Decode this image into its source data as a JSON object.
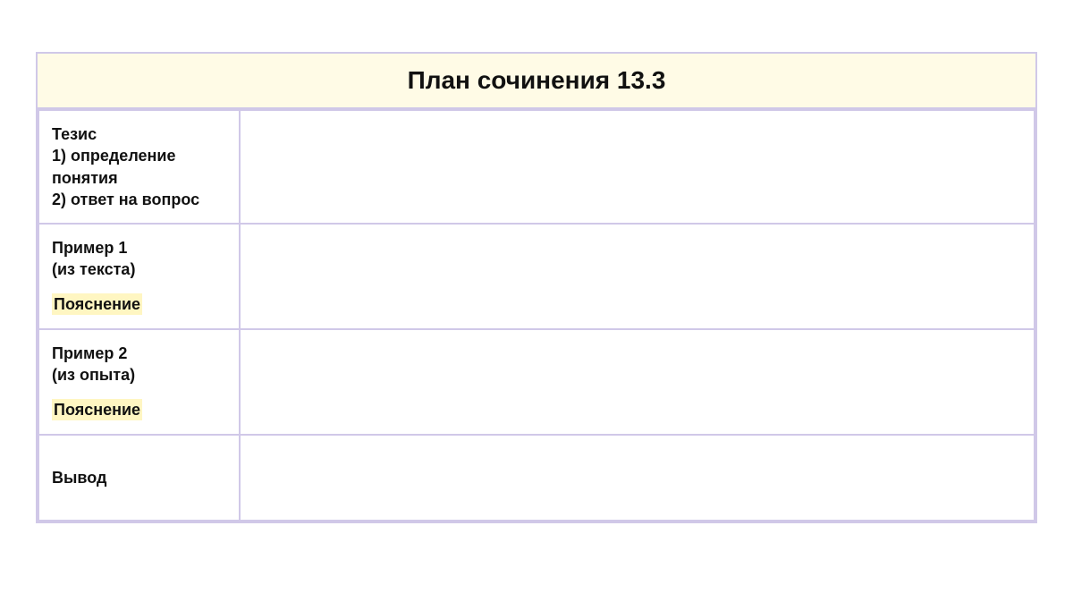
{
  "title": "План сочинения 13.3",
  "rows": {
    "thesis": {
      "heading": "Тезис",
      "line1": "1) определение понятия",
      "line2": "2) ответ на вопрос",
      "content": ""
    },
    "example1": {
      "heading": "Пример 1",
      "sub": "(из текста)",
      "explanation_label": "Пояснение",
      "content": ""
    },
    "example2": {
      "heading": "Пример 2",
      "sub": "(из опыта)",
      "explanation_label": "Пояснение",
      "content": ""
    },
    "conclusion": {
      "heading": "Вывод",
      "content": ""
    }
  }
}
